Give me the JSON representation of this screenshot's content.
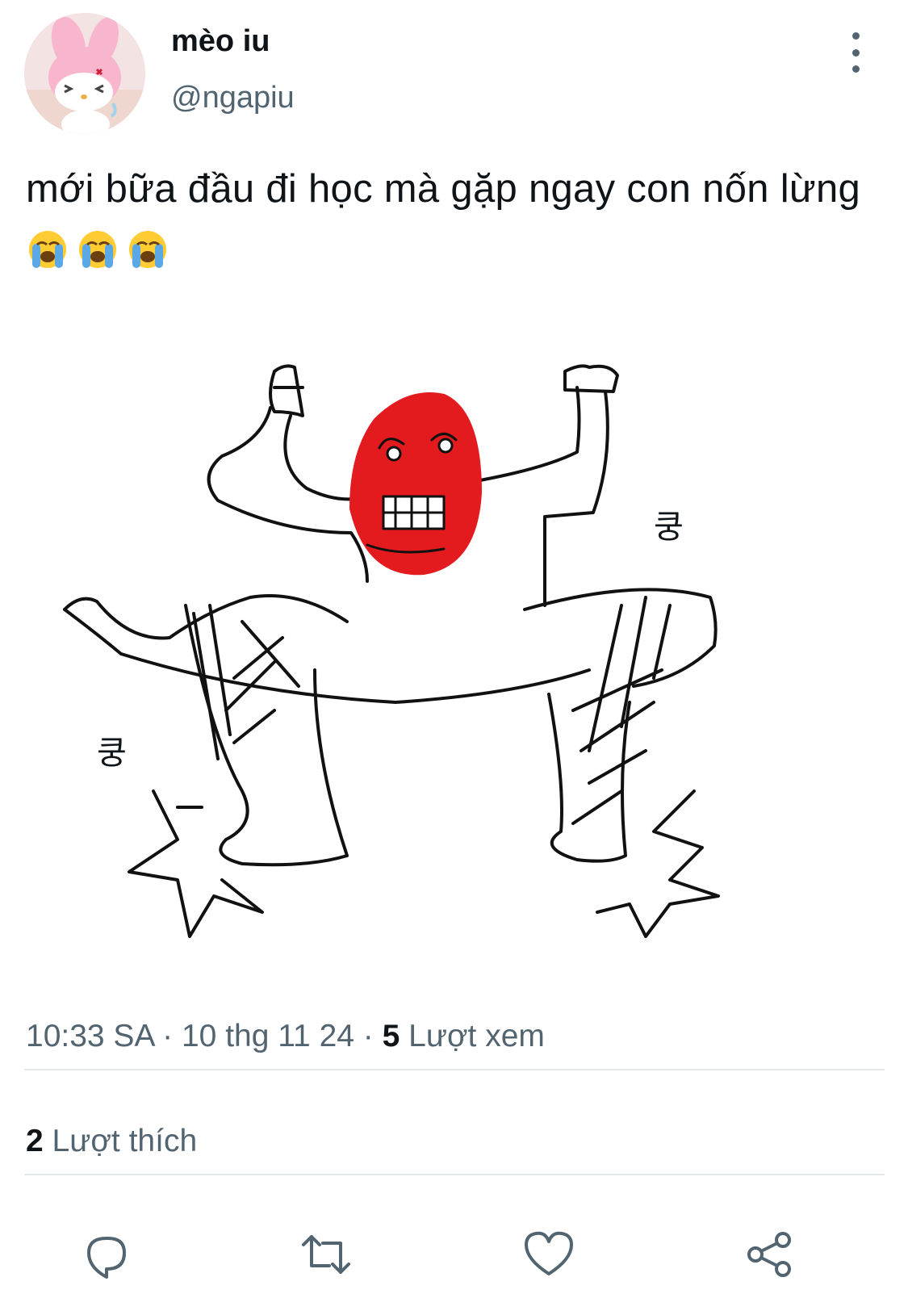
{
  "tweet": {
    "author_name": "mèo iu",
    "author_handle": "@ngapiu",
    "text": "mới bữa đầu đi học mà gặp ngay con nốn lừng",
    "emoji": [
      "😭",
      "😭",
      "😭"
    ],
    "drawing_labels": [
      "쿵",
      "쿵"
    ],
    "time": "10:33 SA",
    "date": "10 thg 11 24",
    "views_count": "5",
    "views_label": "Lượt xem",
    "likes_count": "2",
    "likes_label": "Lượt thích"
  },
  "icons": {
    "more": "more-vertical-icon",
    "reply": "reply-icon",
    "retweet": "retweet-icon",
    "like": "heart-icon",
    "share": "share-icon"
  },
  "colors": {
    "text": "#0f1419",
    "secondary_text": "#536471",
    "divider": "#e4e8eb",
    "face": "#e31b1f"
  }
}
